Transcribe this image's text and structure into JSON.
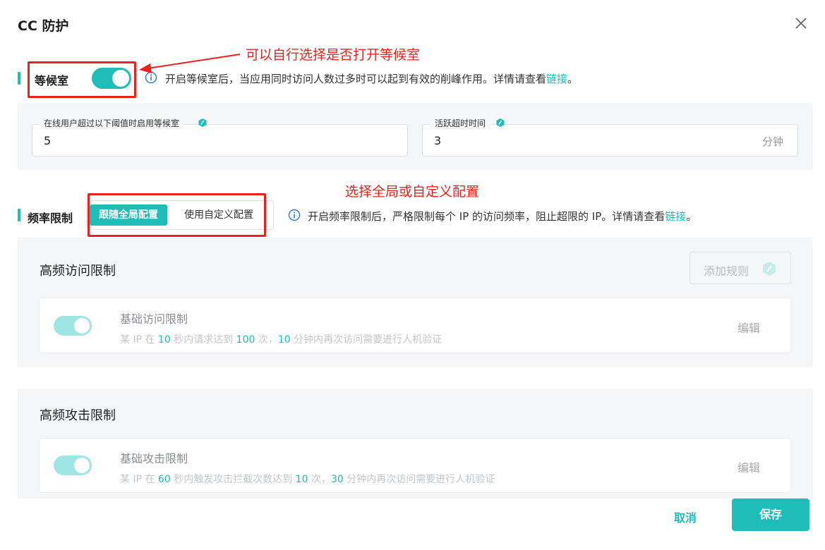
{
  "dialog": {
    "title": "CC 防护"
  },
  "waiting_room": {
    "label": "等候室",
    "enabled": true,
    "info_text": "开启等候室后，当应用同时访问人数过多时可以起到有效的削峰作用。详情请查看",
    "info_link": "链接",
    "info_suffix": "。",
    "threshold_label": "在线用户超过以下阈值时启用等候室",
    "threshold_value": "5",
    "timeout_label": "活跃超时时间",
    "timeout_value": "3",
    "timeout_unit": "分钟"
  },
  "rate_limit": {
    "label": "频率限制",
    "options": [
      "跟随全局配置",
      "使用自定义配置"
    ],
    "selected": "跟随全局配置",
    "info_text": "开启频率限制后，严格限制每个 IP 的访问频率，阻止超限的 IP。详情请查看",
    "info_link": "链接",
    "info_suffix": "。"
  },
  "high_freq_access": {
    "title": "高频访问限制",
    "add_rule_label": "添加规则",
    "rule": {
      "name": "基础访问限制",
      "enabled": true,
      "desc_parts": [
        "某 IP 在 ",
        "10",
        " 秒内请求达到 ",
        "100",
        " 次，",
        "10",
        " 分钟内再次访问需要进行人机验证"
      ],
      "edit_label": "编辑"
    }
  },
  "high_freq_attack": {
    "title": "高频攻击限制",
    "rule": {
      "name": "基础攻击限制",
      "enabled": true,
      "desc_parts": [
        "某 IP 在 ",
        "60",
        " 秒内触发攻击拦截次数达到 ",
        "10",
        " 次，",
        "30",
        " 分钟内再次访问需要进行人机验证"
      ],
      "edit_label": "编辑"
    }
  },
  "annotations": {
    "waiting_room_note": "可以自行选择是否打开等候室",
    "rate_limit_note": "选择全局或自定义配置"
  },
  "footer": {
    "cancel_label": "取消",
    "save_label": "保存"
  },
  "colors": {
    "accent": "#1fbcb8",
    "annotation": "#e8231f"
  },
  "icons": [
    "close-icon",
    "info-icon",
    "hint-icon"
  ]
}
